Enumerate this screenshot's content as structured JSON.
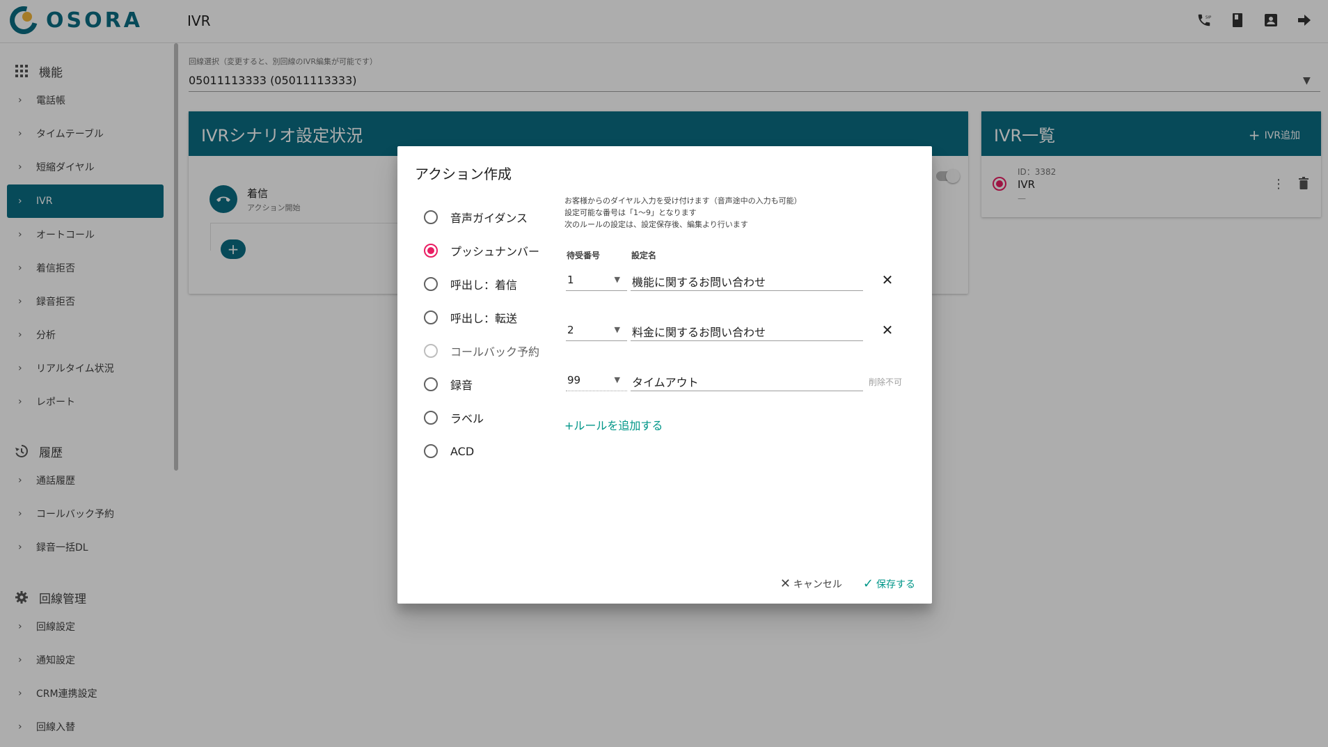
{
  "app": {
    "logo_text": "OSORA",
    "page_title": "IVR"
  },
  "appbar_icons": [
    "sip-phone-icon",
    "book-icon",
    "contact-icon",
    "logout-icon"
  ],
  "sidebar": {
    "sections": [
      {
        "title": "機能",
        "icon": "apps-icon",
        "items": [
          "電話帳",
          "タイムテーブル",
          "短縮ダイヤル",
          "IVR",
          "オートコール",
          "着信拒否",
          "録音拒否",
          "分析",
          "リアルタイム状況",
          "レポート"
        ]
      },
      {
        "title": "履歴",
        "icon": "history-icon",
        "items": [
          "通話履歴",
          "コールバック予約",
          "録音一括DL"
        ]
      },
      {
        "title": "回線管理",
        "icon": "gear-icon",
        "items": [
          "回線設定",
          "通知設定",
          "CRM連携設定",
          "回線入替"
        ]
      }
    ],
    "active_item": "IVR"
  },
  "line_select": {
    "label": "回線選択（変更すると、別回線のIVR編集が可能です）",
    "value": "05011113333 (05011113333)"
  },
  "scenario_card": {
    "title": "IVRシナリオ設定状況",
    "node_title": "着信",
    "node_sub": "アクション開始",
    "add_label": "+"
  },
  "ivr_list": {
    "title": "IVR一覧",
    "add_label": "IVR追加",
    "item_id": "ID：3382",
    "item_name": "IVR",
    "item_sub": "—"
  },
  "dialog": {
    "title": "アクション作成",
    "options": [
      {
        "label": "音声ガイダンス",
        "state": "unchecked"
      },
      {
        "label": "プッシュナンバー",
        "state": "checked"
      },
      {
        "label": "呼出し：着信",
        "state": "unchecked"
      },
      {
        "label": "呼出し：転送",
        "state": "unchecked"
      },
      {
        "label": "コールバック予約",
        "state": "disabled"
      },
      {
        "label": "録音",
        "state": "unchecked"
      },
      {
        "label": "ラベル",
        "state": "unchecked"
      },
      {
        "label": "ACD",
        "state": "unchecked"
      }
    ],
    "description": [
      "お客様からのダイヤル入力を受け付けます（音声途中の入力も可能）",
      "設定可能な番号は「1〜9」となります",
      "次のルールの設定は、設定保存後、編集より行います"
    ],
    "col_number": "待受番号",
    "col_name": "設定名",
    "rules": [
      {
        "number": "1",
        "name": "機能に関するお問い合わせ",
        "deletable": true
      },
      {
        "number": "2",
        "name": "料金に関するお問い合わせ",
        "deletable": true
      },
      {
        "number": "99",
        "name": "タイムアウト",
        "deletable": false,
        "note": "削除不可"
      }
    ],
    "add_rule": "+ルールを追加する",
    "cancel_label": "キャンセル",
    "save_label": "保存する"
  },
  "colors": {
    "primary": "#0b6d83",
    "accent": "#e91e63",
    "action": "#009688",
    "logo_dot": "#f2b63a"
  }
}
